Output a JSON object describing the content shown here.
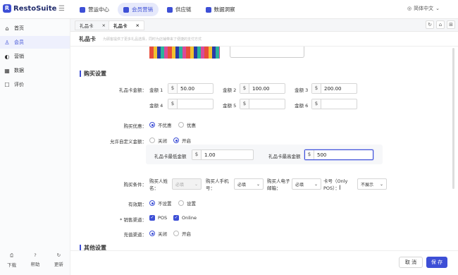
{
  "app": {
    "logo_mark": "R",
    "name": "RestoSuite",
    "collapse_icon": "collapse-icon"
  },
  "topnav": [
    {
      "label": "营运中心",
      "active": false
    },
    {
      "label": "会员营销",
      "active": true
    },
    {
      "label": "供应链",
      "active": false
    },
    {
      "label": "数据洞察",
      "active": false
    }
  ],
  "language": "简体中文",
  "sidebar": {
    "items": [
      {
        "icon": "⌂",
        "label": "首页",
        "active": false
      },
      {
        "icon": "♙",
        "label": "会员",
        "active": true
      },
      {
        "icon": "◐",
        "label": "营销",
        "active": false
      },
      {
        "icon": "▦",
        "label": "数据",
        "active": false
      },
      {
        "icon": "☐",
        "label": "评价",
        "active": false
      }
    ],
    "footer": [
      {
        "icon": "⎙",
        "label": "下载"
      },
      {
        "icon": "?",
        "label": "帮助"
      },
      {
        "icon": "↻",
        "label": "更新"
      }
    ]
  },
  "tabs": [
    {
      "label": "礼品卡",
      "close": "×",
      "active": false
    },
    {
      "label": "礼品卡",
      "close": "×",
      "active": true
    }
  ],
  "tab_tools": [
    "↻",
    "⌂",
    "⊞"
  ],
  "page": {
    "title": "礼品卡",
    "desc": "为顾客提供了更多礼品选择，同时为店铺带来了便捷的支付方式"
  },
  "purchase": {
    "section_title": "购买设置",
    "amount_label": "礼品卡金额：",
    "currency": "$",
    "amounts": [
      {
        "label": "金额 1",
        "value": "50.00"
      },
      {
        "label": "金额 2",
        "value": "100.00"
      },
      {
        "label": "金额 3",
        "value": "200.00"
      },
      {
        "label": "金额 4",
        "value": ""
      },
      {
        "label": "金额 5",
        "value": ""
      },
      {
        "label": "金额 6",
        "value": ""
      }
    ],
    "discount_label": "购买优惠：",
    "discount_options": [
      {
        "label": "不优惠",
        "on": true
      },
      {
        "label": "优惠",
        "on": false
      }
    ],
    "custom_label": "允许自定义金额：",
    "custom_options": [
      {
        "label": "关闭",
        "on": false
      },
      {
        "label": "开启",
        "on": true
      }
    ],
    "min_label": "礼品卡最低金额",
    "min_value": "1.00",
    "max_label": "礼品卡最高金额",
    "max_value": "500",
    "conditions_label": "购买条件：",
    "cond_name_label": "购买人姓名：",
    "cond_name_value": "必填",
    "cond_phone_label": "购买人手机号：",
    "cond_phone_value": "必填",
    "cond_email_label": "购买人电子邮箱：",
    "cond_email_value": "必填",
    "cond_card_label": "卡号（Only POS）：",
    "cond_card_value": "不展示",
    "expiry_label": "有效期：",
    "expiry_options": [
      {
        "label": "不设置",
        "on": true
      },
      {
        "label": "设置",
        "on": false
      }
    ],
    "channel_label": "* 销售渠道：",
    "channel_options": [
      {
        "label": "POS",
        "on": true
      },
      {
        "label": "Online",
        "on": true
      }
    ],
    "recharge_label": "充值渠道：",
    "recharge_options": [
      {
        "label": "关闭",
        "on": true
      },
      {
        "label": "开启",
        "on": false
      }
    ]
  },
  "other_section_title": "其他设置",
  "footer": {
    "cancel": "取 消",
    "save": "保 存"
  }
}
